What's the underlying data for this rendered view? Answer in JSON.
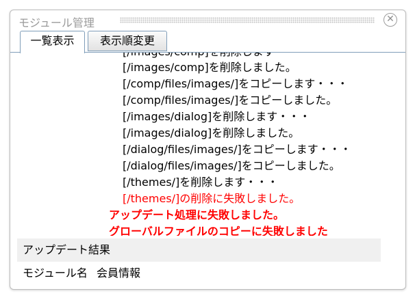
{
  "window": {
    "title": "モジュール管理"
  },
  "tabs": [
    {
      "label": "一覧表示"
    },
    {
      "label": "表示順変更"
    }
  ],
  "log": {
    "lines": [
      {
        "text": "[/images/comp]を削除します・・・",
        "kind": "normal"
      },
      {
        "text": "[/images/comp]を削除しました。",
        "kind": "normal"
      },
      {
        "text": "[/comp/files/images/]をコピーします・・・",
        "kind": "normal"
      },
      {
        "text": "[/comp/files/images/]をコピーしました。",
        "kind": "normal"
      },
      {
        "text": "[/images/dialog]を削除します・・・",
        "kind": "normal"
      },
      {
        "text": "[/images/dialog]を削除しました。",
        "kind": "normal"
      },
      {
        "text": "[/dialog/files/images/]をコピーします・・・",
        "kind": "normal"
      },
      {
        "text": "[/dialog/files/images/]をコピーしました。",
        "kind": "normal"
      },
      {
        "text": "[/themes/]を削除します・・・",
        "kind": "normal"
      },
      {
        "text": "[/themes/]の削除に失敗しました。",
        "kind": "error"
      },
      {
        "text": "アップデート処理に失敗しました。",
        "kind": "fatal"
      },
      {
        "text": "グローバルファイルのコピーに失敗しました",
        "kind": "fatal"
      }
    ]
  },
  "result": {
    "section_title": "アップデート結果",
    "module_label": "モジュール名",
    "module_value": "会員情報"
  },
  "colors": {
    "text": "#000000",
    "error": "#ff0000",
    "tab_border": "#7f9db9",
    "section_bg": "#f0f0f0"
  }
}
